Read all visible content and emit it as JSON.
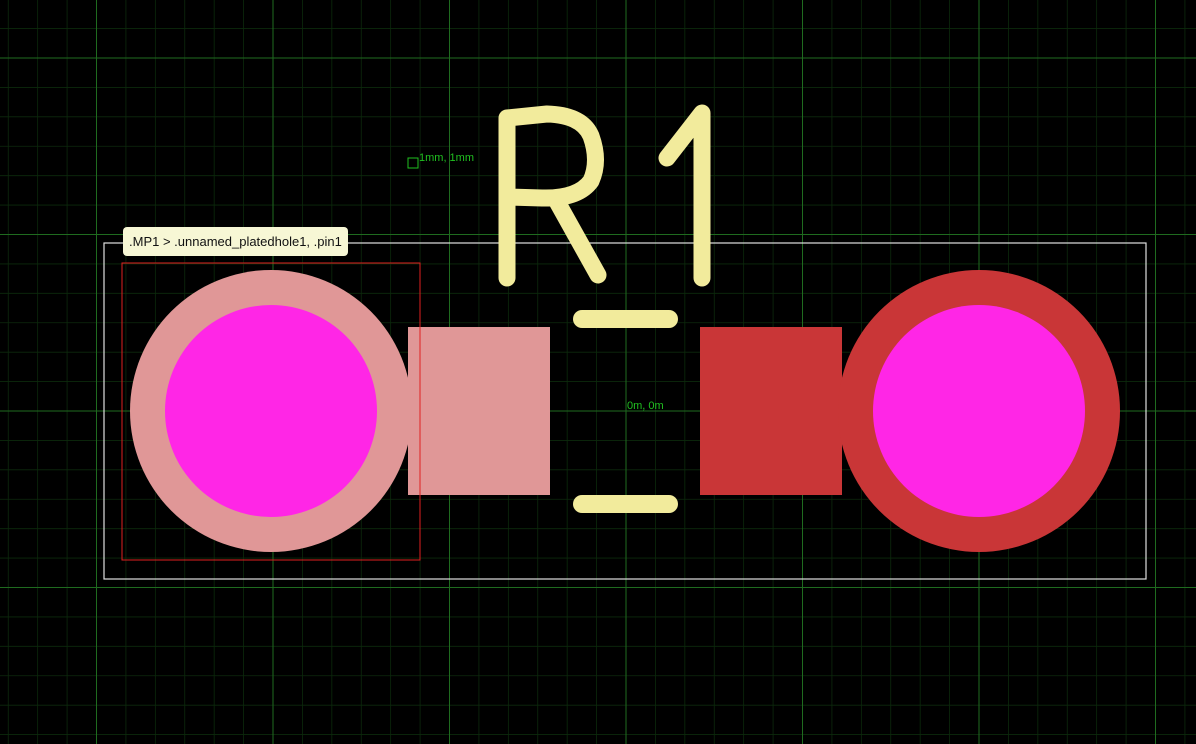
{
  "tooltip": {
    "text": ".MP1 > .unnamed_platedhole1, .pin1"
  },
  "designator": "R1",
  "coords": {
    "grid_step": "1mm, 1mm",
    "origin": "0m, 0m"
  },
  "colors": {
    "background": "#000000",
    "grid_minor": "#0c2a0c",
    "grid_major": "#1f6b1f",
    "silkscreen": "#f2eb9c",
    "pad_left": "#e09797",
    "pad_right": "#c93637",
    "hole": "#ff26e6",
    "selection": "#e02020",
    "outline": "#e0e0e0"
  },
  "icons": [
    "grid-origin-marker-icon"
  ]
}
